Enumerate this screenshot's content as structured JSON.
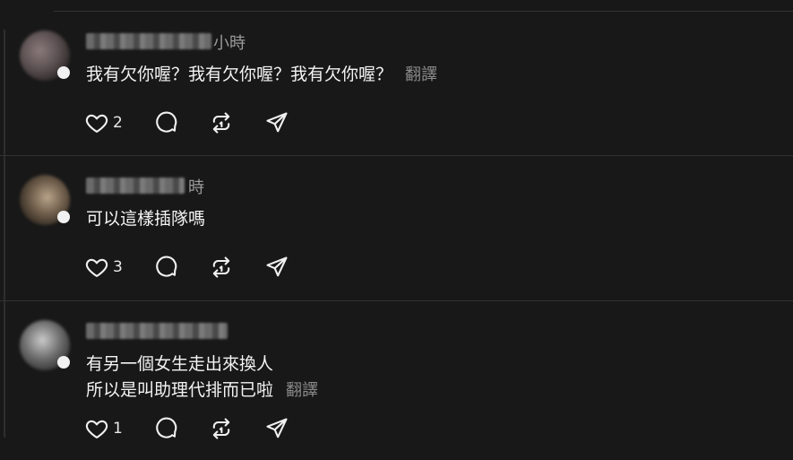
{
  "posts": [
    {
      "time": "小時",
      "text_lines": [
        "我有欠你喔？我有欠你喔？我有欠你喔？"
      ],
      "translate_label": "翻譯",
      "likes": "2"
    },
    {
      "time": "時",
      "text_lines": [
        "可以這樣插隊嗎"
      ],
      "translate_label": "",
      "likes": "3"
    },
    {
      "time": "",
      "text_lines": [
        "有另一個女生走出來換人",
        "所以是叫助理代排而已啦"
      ],
      "translate_label": "翻譯",
      "likes": "1"
    }
  ],
  "icons": {
    "like": "heart-icon",
    "reply": "comment-icon",
    "repost": "repost-icon",
    "share": "send-icon"
  },
  "colors": {
    "background": "#181818",
    "text": "#f3f3f3",
    "muted": "#8a8a8a"
  }
}
